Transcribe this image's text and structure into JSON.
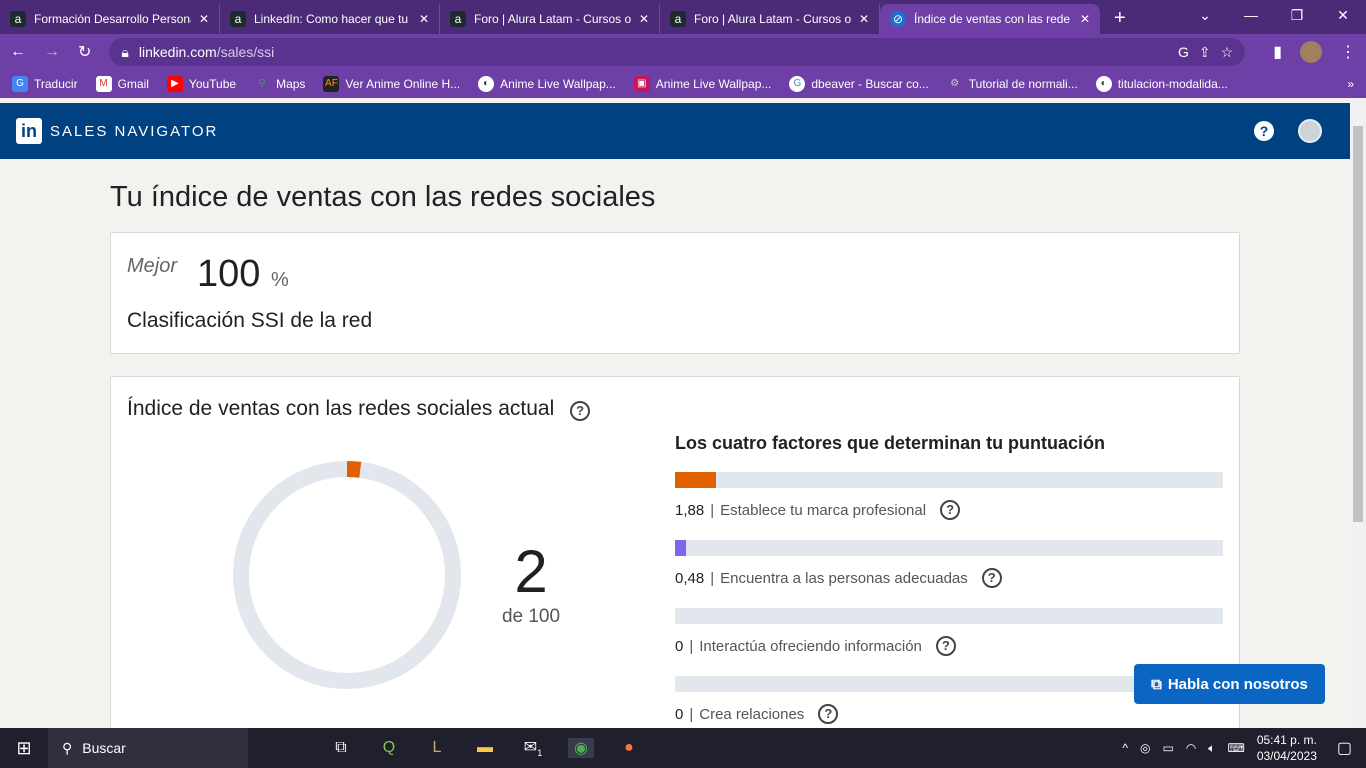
{
  "browser": {
    "tabs": [
      {
        "title": "Formación Desarrollo Personal",
        "favicon": "alura-icon"
      },
      {
        "title": "LinkedIn: Como hacer que tu",
        "favicon": "alura-icon"
      },
      {
        "title": "Foro | Alura Latam - Cursos o",
        "favicon": "alura-icon"
      },
      {
        "title": "Foro | Alura Latam - Cursos o",
        "favicon": "alura-icon"
      },
      {
        "title": "Índice de ventas con las rede",
        "favicon": "linkedin-compass-icon",
        "active": true
      }
    ],
    "url_host": "linkedin.com",
    "url_path": "/sales/ssi",
    "bookmarks": [
      "Traducir",
      "Gmail",
      "YouTube",
      "Maps",
      "Ver Anime Online H...",
      "Anime Live Wallpap...",
      "Anime Live Wallpap...",
      "dbeaver - Buscar co...",
      "Tutorial de normali...",
      "titulacion-modalida..."
    ]
  },
  "nav": {
    "brand": "SALES NAVIGATOR",
    "logo": "in",
    "help": "?"
  },
  "page": {
    "title": "Tu índice de ventas con las redes sociales",
    "rank": {
      "label": "Mejor",
      "value": "100",
      "unit": "%",
      "caption": "Clasificación SSI de la red"
    },
    "ssi": {
      "title": "Índice de ventas con las redes sociales actual",
      "score": "2",
      "of": "de 100",
      "score_fraction": 0.02,
      "factors_title": "Los cuatro factores que determinan tu puntuación",
      "factors": [
        {
          "value": "1,88",
          "label": "Establece tu marca profesional",
          "max": 25,
          "color": "#e06000"
        },
        {
          "value": "0,48",
          "label": "Encuentra a las personas adecuadas",
          "max": 25,
          "color": "#7b68ee"
        },
        {
          "value": "0",
          "label": "Interactúa ofreciendo información",
          "max": 25,
          "color": "#2aa0a4"
        },
        {
          "value": "0",
          "label": "Crea relaciones",
          "max": 25,
          "color": "#0a66c2"
        }
      ]
    },
    "chat": "Habla con nosotros"
  },
  "taskbar": {
    "search": "Buscar",
    "time": "05:41 p. m.",
    "date": "03/04/2023",
    "mail_badge": "1"
  }
}
